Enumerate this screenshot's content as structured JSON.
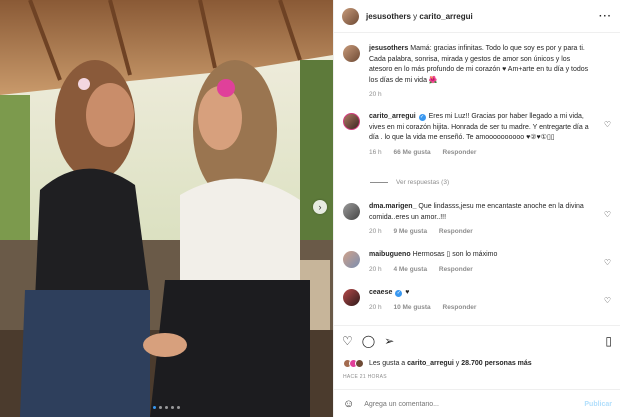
{
  "post": {
    "authors": "jesusothers",
    "connector": "y",
    "coauthor": "carito_arregui",
    "more_icon": "more-icon"
  },
  "caption": {
    "user": "jesusothers",
    "text": "Mamá: gracias infinitas. Todo lo que soy es por y para ti. Cada palabra, sonrisa, mirada y gestos de amor son únicos y los atesoro en lo más profundo de mi corazón ♥ Am+arte en tu día y todos los días de mi vida 🌺",
    "time": "20 h"
  },
  "comments": [
    {
      "user": "carito_arregui",
      "verified": true,
      "text": "Eres mi Luz!! Gracias por haber llegado a mi vida, vives en mi corazón hijita. Honrada de ser tu madre. Y entregarte día a día . lo que la vida me enseñó. Te amoooooooooo ♥②♥①▯▯",
      "time": "16 h",
      "likes": "66 Me gusta",
      "reply": "Responder"
    },
    {
      "user": "dma.marigen_",
      "verified": false,
      "text": "Que lindasss,jesu me encantaste anoche en la divina comida..eres un amor..!!!",
      "time": "20 h",
      "likes": "9 Me gusta",
      "reply": "Responder"
    },
    {
      "user": "maibugueno",
      "verified": false,
      "text": "Hermosas ▯ son lo máximo",
      "time": "20 h",
      "likes": "4 Me gusta",
      "reply": "Responder"
    },
    {
      "user": "ceaese",
      "verified": true,
      "text": "♥",
      "time": "20 h",
      "likes": "10 Me gusta",
      "reply": "Responder"
    }
  ],
  "view_replies": "Ver respuestas (3)",
  "likes_line": {
    "prefix": "Les gusta a",
    "user": "carito_arregui",
    "middle": "y",
    "count": "28.700 personas más"
  },
  "posted": "HACE 21 HORAS",
  "add_comment": {
    "placeholder": "Agrega un comentario...",
    "publish": "Publicar"
  },
  "colors": {
    "accent": "#3897f0",
    "publish": "#b2dffc",
    "muted": "#8e8e8e"
  }
}
